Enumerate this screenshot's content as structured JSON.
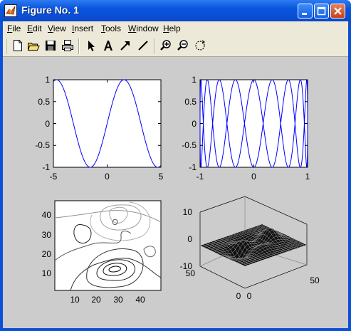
{
  "window": {
    "title": "Figure No. 1",
    "app_icon": "matlab-icon",
    "controls": [
      "minimize-icon",
      "maximize-icon",
      "close-icon"
    ],
    "colors": {
      "titlebar": "#0a50d8",
      "figure_bg": "#cccccc",
      "plot_line": "#0000ff"
    }
  },
  "menubar": {
    "items": [
      {
        "mnemonic": "F",
        "rest": "ile"
      },
      {
        "mnemonic": "E",
        "rest": "dit"
      },
      {
        "mnemonic": "V",
        "rest": "iew"
      },
      {
        "mnemonic": "I",
        "rest": "nsert"
      },
      {
        "mnemonic": "T",
        "rest": "ools"
      },
      {
        "mnemonic": "W",
        "rest": "indow"
      },
      {
        "mnemonic": "H",
        "rest": "elp"
      }
    ]
  },
  "toolbar": {
    "icons": [
      "new-figure-icon",
      "open-folder-icon",
      "save-icon",
      "print-icon",
      "select-arrow-icon",
      "insert-text-icon",
      "insert-arrow-icon",
      "insert-line-icon",
      "zoom-in-icon",
      "zoom-out-icon",
      "rotate-icon"
    ]
  },
  "chart_data": [
    {
      "type": "line",
      "title": "",
      "xlim": [
        -5,
        5
      ],
      "ylim": [
        -1,
        1
      ],
      "xticks": [
        "-5",
        "0",
        "5"
      ],
      "yticks": [
        "1",
        "0.5",
        "0",
        "-0.5",
        "-1"
      ],
      "series": [
        {
          "function": "sin(x)",
          "x_range": [
            -5,
            5
          ]
        }
      ]
    },
    {
      "type": "line",
      "title": "",
      "xlim": [
        -1,
        1
      ],
      "ylim": [
        -1,
        1
      ],
      "xticks": [
        "-1",
        "0",
        "1"
      ],
      "yticks": [
        "1",
        "0.5",
        "0",
        "-0.5",
        "-1"
      ],
      "series": [
        {
          "parametric": "x = sin(t), y = cos(9t)"
        }
      ]
    },
    {
      "type": "contour",
      "title": "",
      "xlim": [
        1,
        49
      ],
      "ylim": [
        1,
        49
      ],
      "xticks": [
        "10",
        "20",
        "30",
        "40"
      ],
      "yticks": [
        "40",
        "30",
        "20",
        "10"
      ]
    },
    {
      "type": "surface",
      "title": "",
      "zlim": [
        -10,
        10
      ],
      "zticks": [
        "10",
        "0",
        "-10"
      ],
      "yticks": [
        "50",
        "0"
      ],
      "xticks": [
        "0",
        "50"
      ]
    }
  ]
}
